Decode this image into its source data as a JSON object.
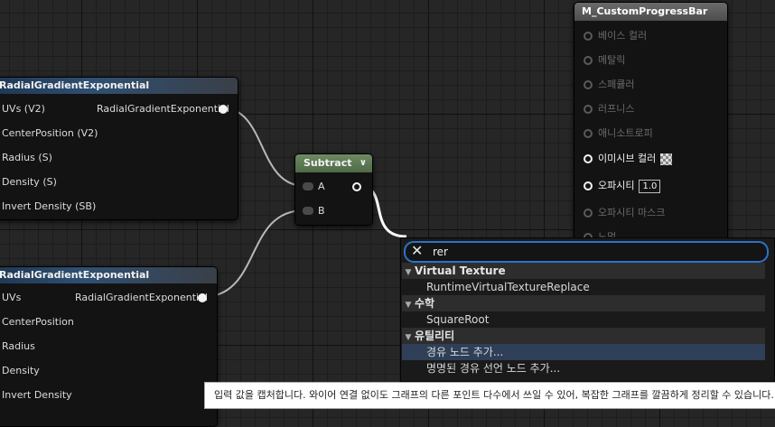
{
  "nodes": {
    "radial1": {
      "title": "RadialGradientExponential",
      "output_label": "RadialGradientExponential",
      "inputs": [
        "UVs (V2)",
        "CenterPosition (V2)",
        "Radius (S)",
        "Density (S)",
        "Invert Density (SB)"
      ]
    },
    "radial2": {
      "title": "RadialGradientExponential",
      "output_label": "RadialGradientExponential",
      "inputs": [
        "UVs",
        "CenterPosition",
        "Radius",
        "Density",
        "Invert Density"
      ]
    },
    "subtract": {
      "title": "Subtract",
      "chevron": "chevron-down-icon",
      "inputs": [
        "A",
        "B"
      ]
    },
    "result": {
      "title": "M_CustomProgressBar",
      "pins": [
        {
          "label": "베이스 컬러",
          "enabled": false
        },
        {
          "label": "메탈릭",
          "enabled": false
        },
        {
          "label": "스페큘러",
          "enabled": false
        },
        {
          "label": "러프니스",
          "enabled": false
        },
        {
          "label": "애니소트로피",
          "enabled": false
        },
        {
          "label": "이미시브 컬러",
          "enabled": true
        },
        {
          "label": "오파시티",
          "enabled": true,
          "value": "1.0"
        },
        {
          "label": "오파시티 마스크",
          "enabled": false
        },
        {
          "label": "노멀",
          "enabled": false
        }
      ]
    }
  },
  "search_popup": {
    "query": "rer",
    "clear_icon": "close-icon",
    "categories": [
      {
        "name": "Virtual Texture",
        "items": [
          "RuntimeVirtualTextureReplace"
        ]
      },
      {
        "name": "수학",
        "items": [
          "SquareRoot"
        ]
      },
      {
        "name": "유틸리티",
        "items": [
          "경유 노드 추가...",
          "명명된 경유 선언 노드 추가..."
        ],
        "selected_index": 0
      }
    ]
  },
  "tooltip": {
    "text": "입력 값을 캡처합니다. 와이어 연결 없이도 그래프의 다른 포인트 다수에서 쓰일 수 있어, 복잡한 그래프를 깔끔하게 정리할 수 있습니다."
  },
  "colors": {
    "accent": "#2a73c9",
    "annotation": "#e0141c",
    "subtract_header": "#5e7b56",
    "radial_header": "#2f4f72"
  }
}
